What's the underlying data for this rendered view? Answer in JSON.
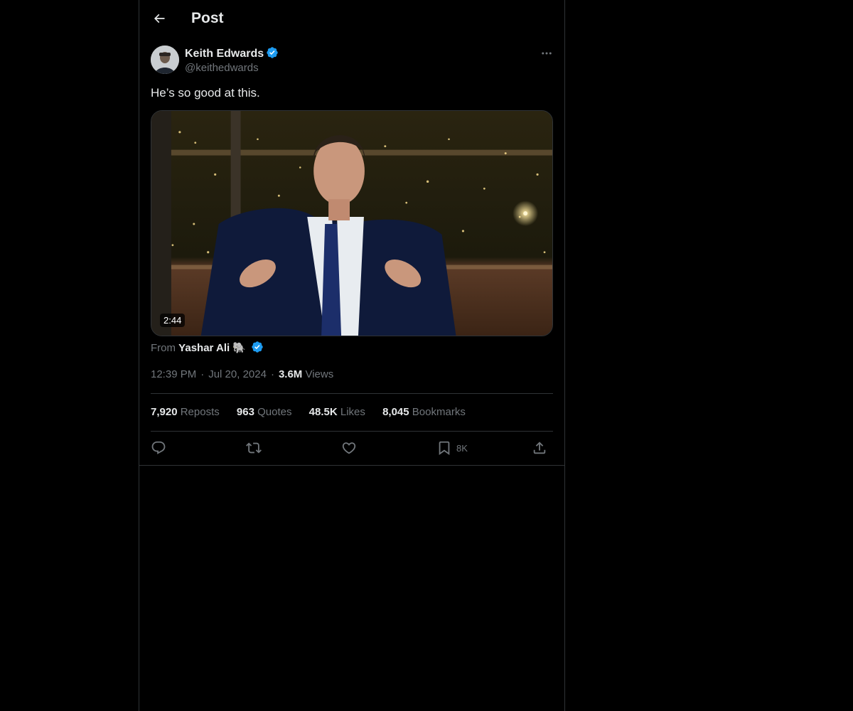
{
  "header": {
    "title": "Post"
  },
  "author": {
    "name": "Keith Edwards",
    "handle": "@keithedwards",
    "verified": true
  },
  "post": {
    "text": "He’s so good at this.",
    "media": {
      "type": "video",
      "duration": "2:44"
    },
    "from": {
      "prefix": "From",
      "name": "Yashar Ali",
      "emoji": "🐘",
      "verified": true
    },
    "time": "12:39 PM",
    "date": "Jul 20, 2024",
    "separator": "·",
    "views_count": "3.6M",
    "views_label": "Views"
  },
  "stats": {
    "reposts": {
      "count": "7,920",
      "label": "Reposts"
    },
    "quotes": {
      "count": "963",
      "label": "Quotes"
    },
    "likes": {
      "count": "48.5K",
      "label": "Likes"
    },
    "bookmarks": {
      "count": "8,045",
      "label": "Bookmarks"
    }
  },
  "actions": {
    "reply": {
      "icon": "reply-icon"
    },
    "repost": {
      "icon": "repost-icon"
    },
    "like": {
      "icon": "heart-icon"
    },
    "bookmark": {
      "icon": "bookmark-icon",
      "count": "8K"
    },
    "share": {
      "icon": "share-icon"
    }
  },
  "colors": {
    "background": "#000000",
    "border": "#2f3336",
    "text_primary": "#e7e9ea",
    "text_secondary": "#71767b",
    "verified_blue": "#1d9bf0"
  }
}
